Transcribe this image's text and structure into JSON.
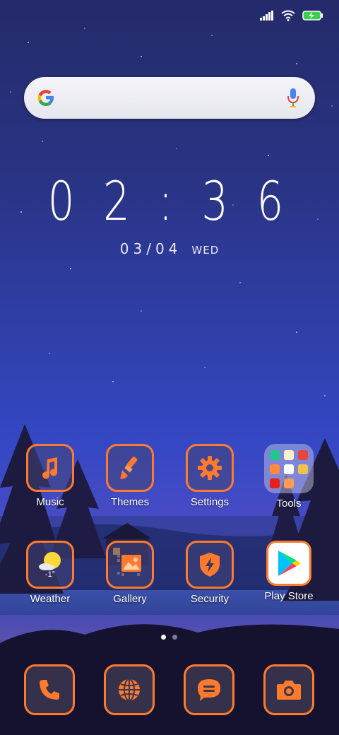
{
  "status_bar": {
    "icons": [
      "signal-icon",
      "wifi-icon",
      "battery-charging-icon"
    ]
  },
  "search_bar": {
    "logo": "google-logo",
    "mic_icon": "microphone-icon"
  },
  "clock": {
    "time": "02:36",
    "date": "03/04",
    "weekday": "WED"
  },
  "apps": [
    {
      "label": "Music",
      "icon": "music-note-icon"
    },
    {
      "label": "Themes",
      "icon": "paintbrush-icon"
    },
    {
      "label": "Settings",
      "icon": "gear-icon"
    },
    {
      "label": "Tools",
      "icon": "folder-icon"
    },
    {
      "label": "Weather",
      "icon": "weather-sun-cloud-icon",
      "temperature": "-1°"
    },
    {
      "label": "Gallery",
      "icon": "gallery-image-icon"
    },
    {
      "label": "Security",
      "icon": "shield-bolt-icon"
    },
    {
      "label": "Play Store",
      "icon": "play-store-icon"
    }
  ],
  "page_indicator": {
    "count": 2,
    "active": 0
  },
  "dock": [
    {
      "name": "Phone",
      "icon": "phone-icon"
    },
    {
      "name": "Browser",
      "icon": "globe-icon"
    },
    {
      "name": "Messages",
      "icon": "chat-bubble-icon"
    },
    {
      "name": "Camera",
      "icon": "camera-icon"
    }
  ],
  "colors": {
    "accent": "#ff7a2c",
    "sky_top": "#242a6a",
    "sky_mid": "#3447c4"
  }
}
